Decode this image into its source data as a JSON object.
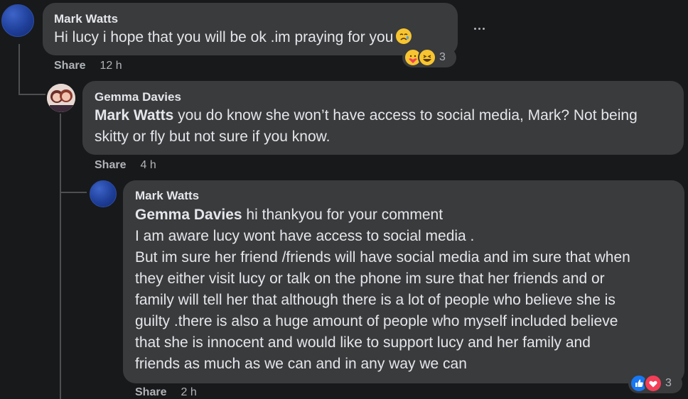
{
  "comments": [
    {
      "author": "Mark Watts",
      "text_lines": [
        "Hi lucy i hope that you will be ok .im praying for you"
      ],
      "share_label": "Share",
      "time": "12 h",
      "reaction_count": "3",
      "reaction_icons": [
        "care-icon",
        "haha-icon"
      ]
    },
    {
      "author": "Gemma Davies",
      "mention": "Mark Watts",
      "text_lines": [
        " you do know she won’t have access to social media, Mark? Not being",
        "skitty or fly but not sure if you know."
      ],
      "share_label": "Share",
      "time": "4 h"
    },
    {
      "author": "Mark Watts",
      "mention": "Gemma Davies",
      "text_lines": [
        " hi thankyou for your comment",
        "I am aware lucy wont have access to social media .",
        "But im sure her friend /friends will have social media and im sure that when",
        "they either visit lucy or talk on the phone im sure that her friends and or",
        "family will tell her that although there is a lot of people who believe she is",
        "guilty .there is also a huge amount of people who myself included believe",
        "that she is innocent and would like to support lucy and her family and",
        "friends as much as we can and in any way we can"
      ],
      "share_label": "Share",
      "time": "2 h",
      "reaction_count": "3",
      "reaction_icons": [
        "like-icon",
        "love-icon"
      ]
    }
  ],
  "colors": {
    "background": "#18191a",
    "bubble": "#3a3b3c",
    "text": "#e4e6eb",
    "meta": "#b0b3b8",
    "like": "#1877f2",
    "love": "#f33e58"
  }
}
